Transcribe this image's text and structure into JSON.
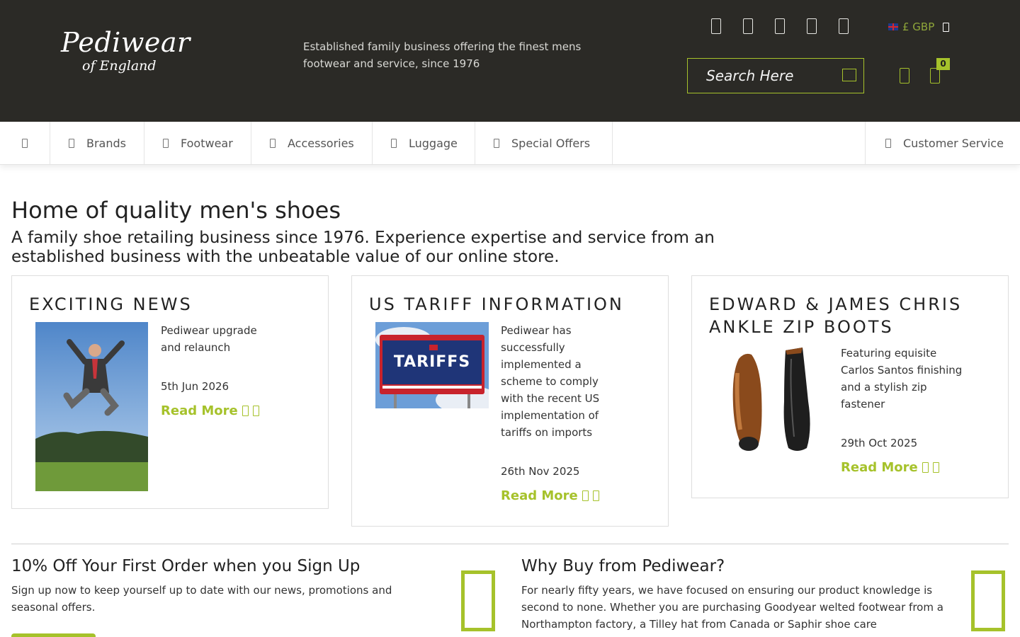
{
  "header": {
    "logo_line1": "Pediwear",
    "logo_line2": "of England",
    "tagline": "Established family business offering the finest mens footwear and service, since 1976",
    "social_icons": [
      "facebook-icon",
      "twitter-icon",
      "instagram-icon",
      "pinterest-icon",
      "youtube-icon"
    ],
    "currency": "£ GBP",
    "search_placeholder": "Search Here",
    "cart_count": "0"
  },
  "nav": {
    "home_icon": "home-icon",
    "items": [
      {
        "label": "Brands"
      },
      {
        "label": "Footwear"
      },
      {
        "label": "Accessories"
      },
      {
        "label": "Luggage"
      },
      {
        "label": "Special Offers"
      }
    ],
    "customer_service": "Customer Service"
  },
  "main": {
    "title": "Home of quality men's shoes",
    "intro": "A family shoe retailing business since 1976. Experience expertise and service from an established business with the unbeatable value of our online store."
  },
  "cards": [
    {
      "title": "EXCITING NEWS",
      "text": "Pediwear upgrade and relaunch",
      "date": "5th Jun 2026",
      "link": "Read More"
    },
    {
      "title": "US TARIFF INFORMATION",
      "text": "Pediwear has successfully implemented a scheme to comply with the recent US implementation of tariffs on imports",
      "date": "26th Nov 2025",
      "link": "Read More",
      "image_text": "TARIFFS"
    },
    {
      "title": "EDWARD & JAMES CHRIS ANKLE ZIP BOOTS",
      "text": "Featuring equisite Carlos Santos finishing and a stylish zip fastener",
      "date": "29th Oct 2025",
      "link": "Read More"
    }
  ],
  "promo": {
    "signup_title": "10% Off Your First Order when you Sign Up",
    "signup_text": "Sign up now to keep yourself up to date with our news, promotions and seasonal offers.",
    "why_title": "Why Buy from Pediwear?",
    "why_text": "For nearly fifty years, we have focused on ensuring our product knowledge is second to none. Whether you are purchasing Goodyear welted footwear from a Northampton factory, a Tilley hat from Canada or Saphir shoe care"
  },
  "colors": {
    "accent": "#a6c22b",
    "header_bg": "#2b2a26"
  }
}
